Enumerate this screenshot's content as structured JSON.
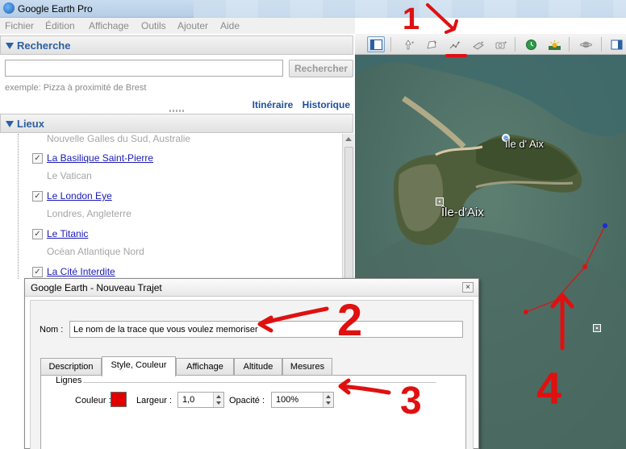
{
  "window": {
    "title": "Google Earth Pro"
  },
  "menu": [
    "Fichier",
    "Édition",
    "Affichage",
    "Outils",
    "Ajouter",
    "Aide"
  ],
  "search": {
    "header": "Recherche",
    "input_value": "",
    "button": "Recherche",
    "button_full": "Rechercher",
    "hint": "exemple: Pizza à proximité de Brest",
    "links": [
      "Itinéraire",
      "Historique"
    ]
  },
  "places": {
    "header": "Lieux",
    "items": [
      {
        "sub": "Nouvelle Galles du Sud, Australie"
      },
      {
        "name": "La Basilique Saint-Pierre",
        "sub": "Le Vatican",
        "checked": true
      },
      {
        "name": "Le London Eye",
        "sub": "Londres, Angleterre",
        "checked": true
      },
      {
        "name": "Le Titanic",
        "sub": "Océan Atlantique Nord",
        "checked": true
      },
      {
        "name": "La Cité Interdite",
        "checked": true
      }
    ]
  },
  "toolbar": {
    "icons": [
      "sidebar-toggle-icon",
      "add-placemark-icon",
      "add-polygon-icon",
      "add-path-icon",
      "add-overlay-icon",
      "record-tour-icon",
      "historical-imagery-icon",
      "sunlight-icon",
      "planets-icon"
    ]
  },
  "map": {
    "labels": [
      {
        "text": "Île d' Aix"
      },
      {
        "text": "Île-d'Aix"
      }
    ]
  },
  "dialog": {
    "title": "Google Earth - Nouveau Trajet",
    "close": "×",
    "name_label": "Nom :",
    "name_value": "Le nom de la trace que vous voulez memoriser",
    "tabs": [
      "Description",
      "Style, Couleur",
      "Affichage",
      "Altitude",
      "Mesures"
    ],
    "selected_tab": "Style, Couleur",
    "group_label": "Lignes",
    "color_label": "Couleur :",
    "color_value": "#e00000",
    "width_label": "Largeur :",
    "width_value": "1,0",
    "opacity_label": "Opacité :",
    "opacity_value": "100%"
  },
  "annotations": [
    "1",
    "2",
    "3",
    "4"
  ]
}
